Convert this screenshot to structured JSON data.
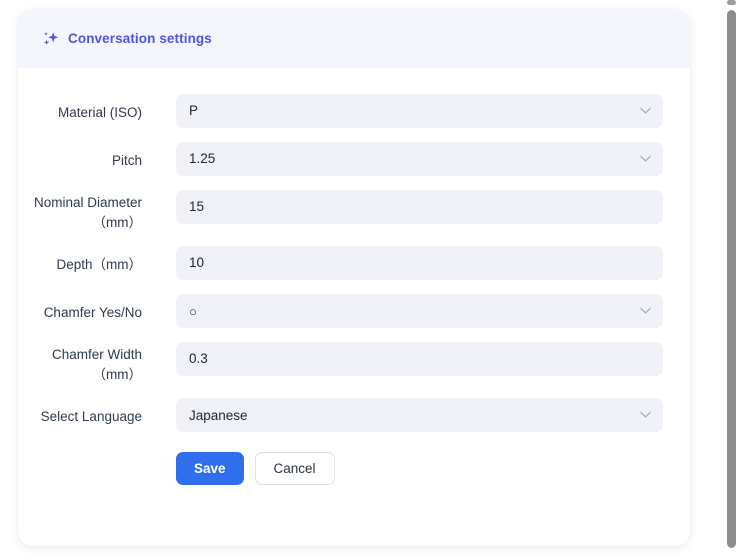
{
  "header": {
    "icon": "sparkle-icon",
    "title": "Conversation settings",
    "title_color": "#4f55e0",
    "background": "#f4f6fd"
  },
  "form": {
    "fields": [
      {
        "label": "Material (ISO)",
        "value": "P",
        "type": "select",
        "two_line": false
      },
      {
        "label": "Pitch",
        "value": "1.25",
        "type": "select",
        "two_line": false
      },
      {
        "label": "Nominal Diameter（mm）",
        "value": "15",
        "type": "text",
        "two_line": true
      },
      {
        "label": "Depth（mm）",
        "value": "10",
        "type": "text",
        "two_line": false
      },
      {
        "label": "Chamfer Yes/No",
        "value": "○",
        "type": "select",
        "two_line": false
      },
      {
        "label": "Chamfer Width（mm）",
        "value": "0.3",
        "type": "text",
        "two_line": true
      },
      {
        "label": "Select Language",
        "value": "Japanese",
        "type": "select",
        "two_line": false
      }
    ]
  },
  "actions": {
    "save_label": "Save",
    "cancel_label": "Cancel",
    "save_color": "#2f6fed"
  },
  "scrollbar": {
    "thumb_color": "#8e8e8e"
  }
}
